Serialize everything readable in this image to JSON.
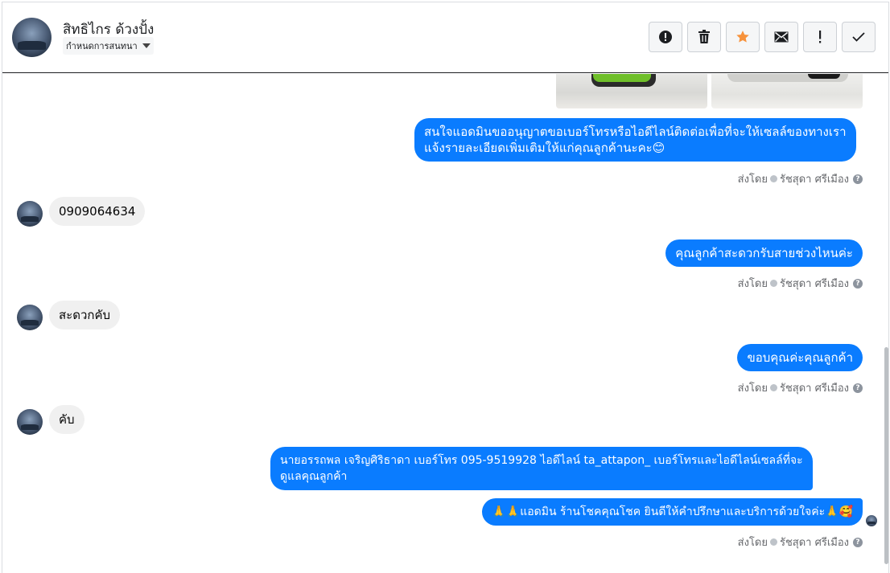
{
  "header": {
    "contact_name": "สิทธิไกร ด้วงปั้ง",
    "assign_label": "กำหนดการสนทนา",
    "toolbar": [
      {
        "name": "spam-button",
        "icon": "alert-circle-icon"
      },
      {
        "name": "delete-button",
        "icon": "trash-icon"
      },
      {
        "name": "star-button",
        "icon": "star-icon",
        "color": "#f7923b"
      },
      {
        "name": "mark-unread-button",
        "icon": "envelope-icon"
      },
      {
        "name": "mark-important-button",
        "icon": "exclamation-icon"
      },
      {
        "name": "mark-done-button",
        "icon": "check-icon"
      }
    ]
  },
  "messages": {
    "m1": "สนใจแอดมินขออนุญาตขอเบอร์โทรหรือไอดีไลน์ติดต่อเพื่อที่จะให้เซลล์ของทางเรา",
    "m1b": "แจ้งรายละเอียดเพิ่มเติมให้แก่คุณลูกค้านะคะ😊",
    "m2": "0909064634",
    "m3": "คุณลูกค้าสะดวกรับสายช่วงไหนค่ะ",
    "m4": "สะดวกคับ",
    "m5": "ขอบคุณค่ะคุณลูกค้า",
    "m6": "คับ",
    "m7": "นายอรรถพล เจริญศิริธาดา      เบอร์โทร 095-9519928 ไอดีไลน์ ta_attapon_   เบอร์โทรและไอดีไลน์เซลล์ที่จะ",
    "m7b": "ดูแลคุณลูกค้า",
    "m8": "🙏🙏แอดมิน ร้านโชคคุณโชค ยินดีให้คำปรึกษาและบริการด้วยใจค่ะ🙏🥰"
  },
  "sent_by": {
    "prefix": "ส่งโดย",
    "agent": "รัชสุดา ศรีเมือง",
    "help": "?"
  },
  "colors": {
    "outgoing_bubble": "#0a7cff",
    "incoming_bubble": "#f0f0f0",
    "accent_star": "#f7923b"
  }
}
